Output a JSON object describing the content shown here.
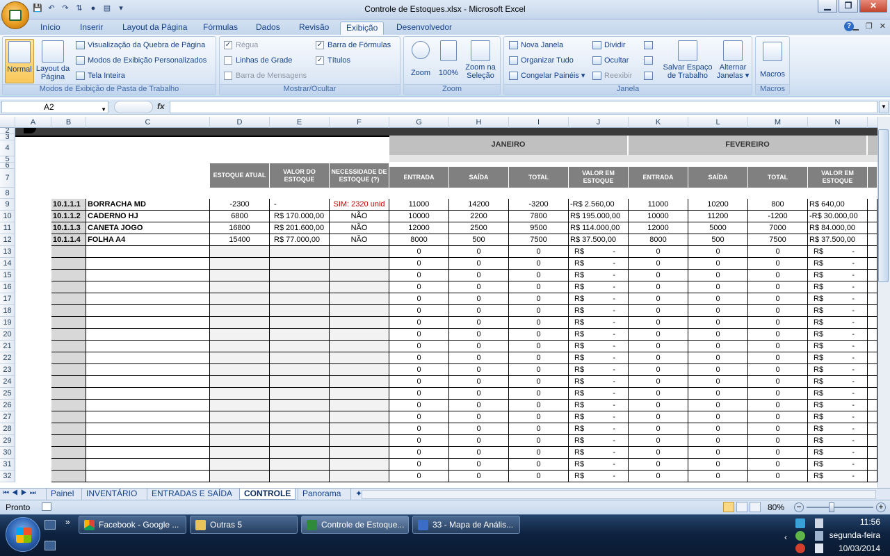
{
  "window": {
    "title": "Controle de Estoques.xlsx - Microsoft Excel",
    "buttons": [
      "▁",
      "❐",
      "✕"
    ]
  },
  "ribbon_tabs": [
    "Início",
    "Inserir",
    "Layout da Página",
    "Fórmulas",
    "Dados",
    "Revisão",
    "Exibição",
    "Desenvolvedor"
  ],
  "active_tab": "Exibição",
  "groups": {
    "modos": {
      "label": "Modos de Exibição de Pasta de Trabalho",
      "normal": "Normal",
      "layout": "Layout da Página",
      "quebra": "Visualização da Quebra de Página",
      "personalizados": "Modos de Exibição Personalizados",
      "tela_inteira": "Tela Inteira"
    },
    "mostrar": {
      "label": "Mostrar/Ocultar",
      "regua": "Régua",
      "linhas_grade": "Linhas de Grade",
      "barra_mensagens": "Barra de Mensagens",
      "barra_formulas": "Barra de Fórmulas",
      "titulos": "Títulos"
    },
    "zoom": {
      "label": "Zoom",
      "zoom": "Zoom",
      "cem": "100%",
      "selecao": "Zoom na Seleção"
    },
    "janela": {
      "label": "Janela",
      "nova": "Nova Janela",
      "organizar": "Organizar Tudo",
      "congelar": "Congelar Painéis",
      "dividir": "Dividir",
      "ocultar": "Ocultar",
      "reexibir": "Reexibir",
      "salvar": "Salvar Espaço de Trabalho",
      "alternar": "Alternar Janelas"
    },
    "macros": {
      "label": "Macros",
      "macros": "Macros"
    }
  },
  "formula_bar": {
    "name_box": "A2",
    "fx": "fx",
    "content": ""
  },
  "columns": [
    "A",
    "B",
    "C",
    "D",
    "E",
    "F",
    "G",
    "H",
    "I",
    "J",
    "K",
    "L",
    "M",
    "N"
  ],
  "row_numbers": [
    "2",
    "3",
    "4",
    "5",
    "6",
    "7",
    "8",
    "9",
    "10",
    "11",
    "12",
    "13",
    "14",
    "15",
    "16",
    "17",
    "18",
    "19",
    "20",
    "21",
    "22",
    "23",
    "24",
    "25",
    "26",
    "27",
    "28",
    "29",
    "30",
    "31",
    "32"
  ],
  "header_labels": {
    "estoque_atual": "ESTOQUE ATUAL",
    "valor_estoque": "VALOR DO ESTOQUE",
    "necessidade": "NECESSIDADE DE ESTOQUE (?)",
    "months": [
      "JANEIRO",
      "FEVEREIRO"
    ],
    "month_cols": [
      "ENTRADA",
      "SAÍDA",
      "TOTAL",
      "VALOR EM ESTOQUE"
    ]
  },
  "items": [
    {
      "code": "10.1.1.1",
      "name": "BORRACHA MD",
      "estoque": "-2300",
      "valor": "-",
      "necessidade": "SIM: 2320 unid",
      "jan": [
        "11000",
        "14200",
        "-3200",
        "-R$     2.560,00"
      ],
      "fev": [
        "11000",
        "10200",
        "800",
        "R$       640,00"
      ]
    },
    {
      "code": "10.1.1.2",
      "name": "CADERNO HJ",
      "estoque": "6800",
      "valor": "R$  170.000,00",
      "necessidade": "NÃO",
      "jan": [
        "10000",
        "2200",
        "7800",
        "R$  195.000,00"
      ],
      "fev": [
        "10000",
        "11200",
        "-1200",
        "-R$   30.000,00"
      ]
    },
    {
      "code": "10.1.1.3",
      "name": "CANETA JOGO",
      "estoque": "16800",
      "valor": "R$  201.600,00",
      "necessidade": "NÃO",
      "jan": [
        "12000",
        "2500",
        "9500",
        "R$  114.000,00"
      ],
      "fev": [
        "12000",
        "5000",
        "7000",
        "R$   84.000,00"
      ]
    },
    {
      "code": "10.1.1.4",
      "name": "FOLHA A4",
      "estoque": "15400",
      "valor": "R$    77.000,00",
      "necessidade": "NÃO",
      "jan": [
        "8000",
        "500",
        "7500",
        "R$    37.500,00"
      ],
      "fev": [
        "8000",
        "500",
        "7500",
        "R$   37.500,00"
      ]
    }
  ],
  "empty_row": {
    "num": "0",
    "rs": "R$",
    "dash": "-"
  },
  "sheet_tabs": [
    "Painel",
    "INVENTÁRIO",
    "ENTRADAS E SAÍDA",
    "CONTROLE",
    "Panorama"
  ],
  "active_sheet": "CONTROLE",
  "status": {
    "ready": "Pronto",
    "zoom": "80%"
  },
  "taskbar": {
    "items": [
      "Facebook - Google ...",
      "Outras 5",
      "Controle de Estoque...",
      "33 - Mapa de Anális..."
    ],
    "time": "11:56",
    "day": "segunda-feira",
    "date": "10/03/2014"
  }
}
